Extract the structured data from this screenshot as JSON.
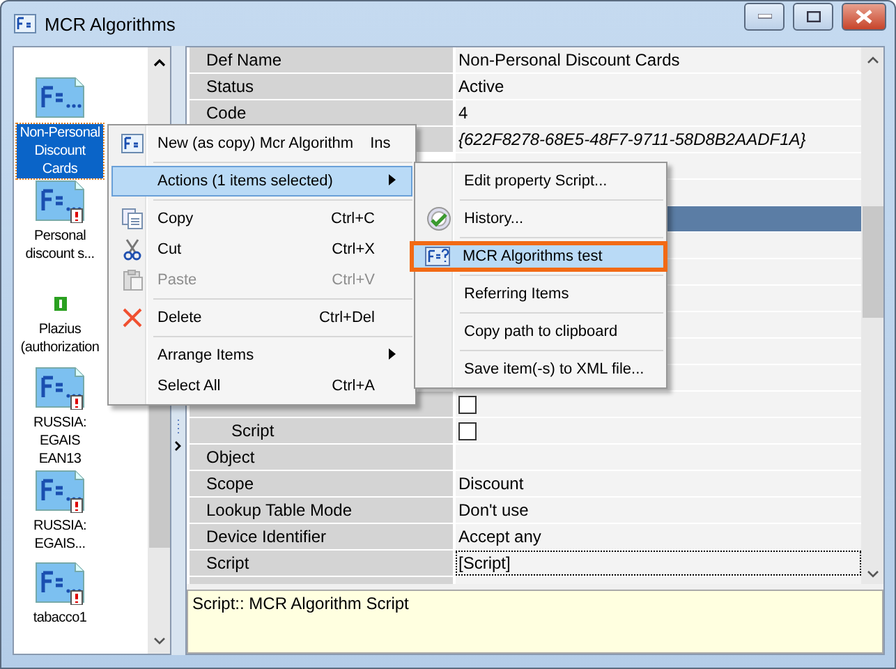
{
  "window": {
    "title": "MCR Algorithms"
  },
  "sidebar": {
    "items": [
      {
        "label": "Non-Personal Discount Cards",
        "selected": true,
        "kind": "formula"
      },
      {
        "label": "Personal discount s...",
        "selected": false,
        "kind": "formula-warning"
      },
      {
        "label": "Plazius (authorization",
        "selected": false,
        "kind": "badge"
      },
      {
        "label": "RUSSIA: EGAIS EAN13",
        "selected": false,
        "kind": "formula-warning"
      },
      {
        "label": "RUSSIA: EGAIS...",
        "selected": false,
        "kind": "formula-warning"
      },
      {
        "label": "tabacco1",
        "selected": false,
        "kind": "formula-warning"
      }
    ]
  },
  "property_grid": {
    "rows": [
      {
        "label": "Def Name",
        "value": "Non-Personal Discount Cards",
        "kind": "text",
        "selected": false
      },
      {
        "label": "Status",
        "value": "Active",
        "kind": "text",
        "selected": false
      },
      {
        "label": "Code",
        "value": "4",
        "kind": "text",
        "selected": false
      },
      {
        "value": "{622F8278-68E5-48F7-9711-58D8B2AADF1A}",
        "kind": "italic",
        "selected": false
      },
      {
        "kind": "blank",
        "selected": false
      },
      {
        "kind": "blank",
        "selected": false
      },
      {
        "kind": "blank",
        "selected": true
      },
      {
        "kind": "blank",
        "selected": false
      },
      {
        "kind": "blank",
        "selected": false
      },
      {
        "kind": "blank",
        "selected": false
      },
      {
        "kind": "blank",
        "selected": false
      },
      {
        "kind": "blank",
        "selected": false
      },
      {
        "kind": "blank",
        "selected": false
      },
      {
        "kind": "subcheck",
        "checked": false,
        "selected": false
      },
      {
        "label": "Script",
        "kind": "subcheck",
        "checked": false,
        "selected": false
      },
      {
        "label": "Object",
        "kind": "text",
        "value": "",
        "selected": false
      },
      {
        "label": "Scope",
        "value": "Discount",
        "kind": "text",
        "selected": false
      },
      {
        "label": "Lookup Table Mode",
        "value": "Don't use",
        "kind": "text",
        "selected": false
      },
      {
        "label": "Device Identifier",
        "value": "Accept any",
        "kind": "text",
        "selected": false
      },
      {
        "label": "Script",
        "value": "[Script]",
        "kind": "focused",
        "selected": false
      }
    ]
  },
  "description": "Script:: MCR Algorithm Script",
  "context_menu": {
    "items": [
      {
        "kind": "new",
        "label": "New (as copy) Mcr Algorithm",
        "shortcut": "Ins",
        "selected": false,
        "disabled": false
      },
      {
        "kind": "separator"
      },
      {
        "kind": "submenu",
        "label": "Actions (1 items selected)",
        "selected": true,
        "disabled": false
      },
      {
        "kind": "separator"
      },
      {
        "kind": "copy",
        "label": "Copy",
        "shortcut": "Ctrl+C",
        "selected": false,
        "disabled": false
      },
      {
        "kind": "cut",
        "label": "Cut",
        "shortcut": "Ctrl+X",
        "selected": false,
        "disabled": false
      },
      {
        "kind": "paste",
        "label": "Paste",
        "shortcut": "Ctrl+V",
        "selected": false,
        "disabled": true
      },
      {
        "kind": "separator"
      },
      {
        "kind": "delete",
        "label": "Delete",
        "shortcut": "Ctrl+Del",
        "selected": false,
        "disabled": false
      },
      {
        "kind": "separator"
      },
      {
        "kind": "submenu",
        "label": "Arrange Items",
        "selected": false,
        "disabled": false
      },
      {
        "kind": "plain",
        "label": "Select All",
        "shortcut": "Ctrl+A",
        "selected": false,
        "disabled": false
      }
    ]
  },
  "submenu": {
    "items": [
      {
        "kind": "plain",
        "label": "Edit property Script...",
        "selected": false
      },
      {
        "kind": "separator"
      },
      {
        "kind": "history",
        "label": "History...",
        "selected": false
      },
      {
        "kind": "separator"
      },
      {
        "kind": "test",
        "label": "MCR Algorithms test",
        "selected": true
      },
      {
        "kind": "separator"
      },
      {
        "kind": "plain",
        "label": "Referring Items",
        "selected": false
      },
      {
        "kind": "separator"
      },
      {
        "kind": "plain",
        "label": "Copy path to clipboard",
        "selected": false
      },
      {
        "kind": "separator"
      },
      {
        "kind": "plain",
        "label": "Save item(-s) to XML file...",
        "selected": false
      }
    ]
  }
}
